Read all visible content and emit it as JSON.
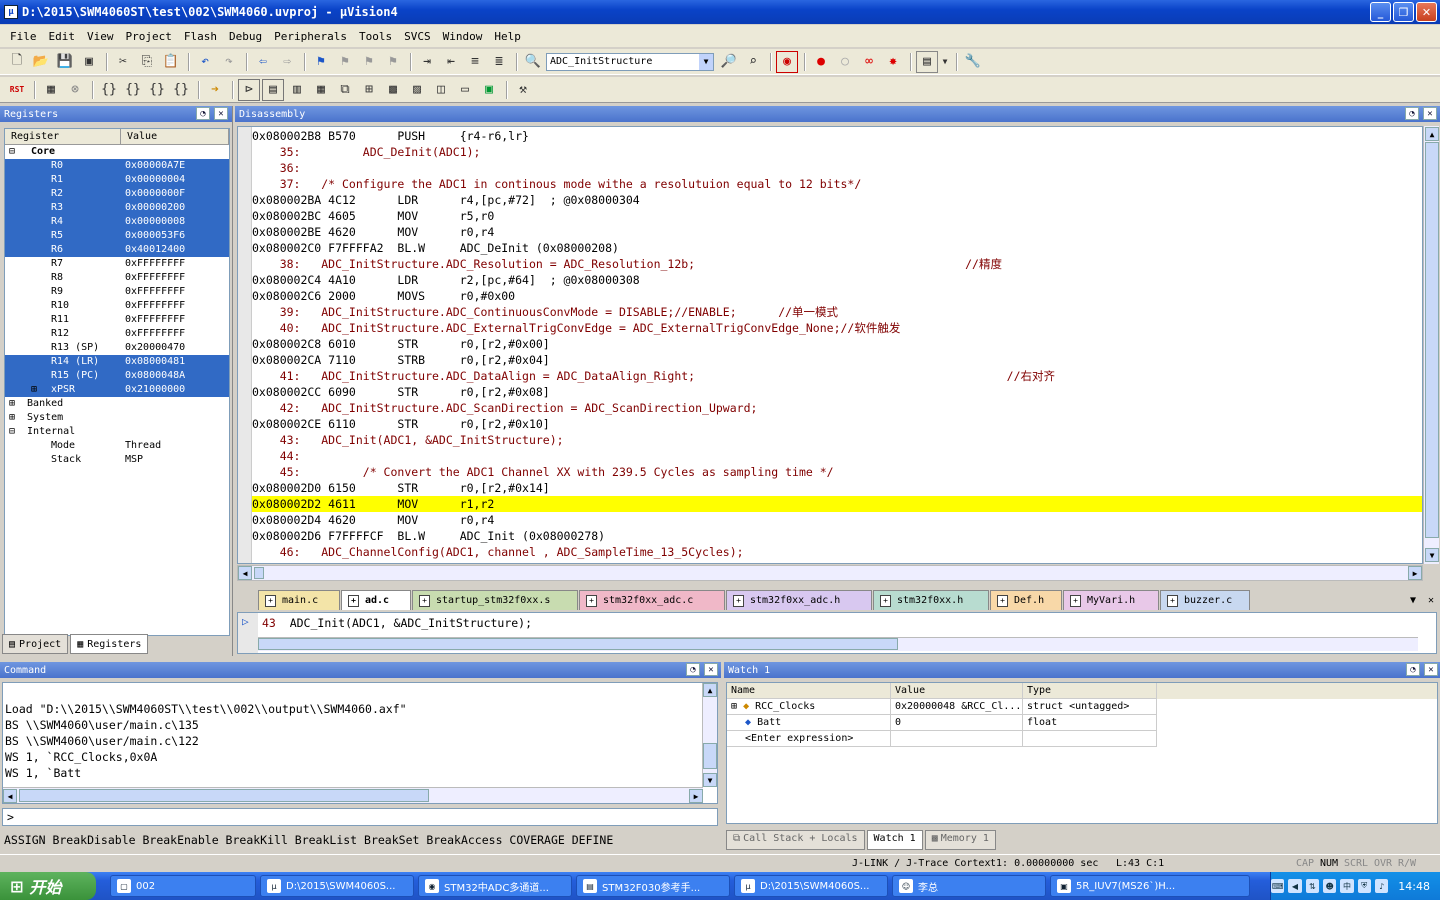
{
  "title": "D:\\2015\\SWM4060ST\\test\\002\\SWM4060.uvproj - µVision4",
  "menu": [
    "File",
    "Edit",
    "View",
    "Project",
    "Flash",
    "Debug",
    "Peripherals",
    "Tools",
    "SVCS",
    "Window",
    "Help"
  ],
  "toolbar": {
    "combo_value": "ADC_InitStructure",
    "rst": "RST"
  },
  "registers": {
    "title": "Registers",
    "col_register": "Register",
    "col_value": "Value",
    "core": "Core",
    "rows": [
      {
        "n": "R0",
        "v": "0x00000A7E",
        "sel": true
      },
      {
        "n": "R1",
        "v": "0x00000004",
        "sel": true
      },
      {
        "n": "R2",
        "v": "0x0000000F",
        "sel": true
      },
      {
        "n": "R3",
        "v": "0x00000200",
        "sel": true
      },
      {
        "n": "R4",
        "v": "0x00000008",
        "sel": true
      },
      {
        "n": "R5",
        "v": "0x000053F6",
        "sel": true
      },
      {
        "n": "R6",
        "v": "0x40012400",
        "sel": true
      },
      {
        "n": "R7",
        "v": "0xFFFFFFFF",
        "sel": false
      },
      {
        "n": "R8",
        "v": "0xFFFFFFFF",
        "sel": false
      },
      {
        "n": "R9",
        "v": "0xFFFFFFFF",
        "sel": false
      },
      {
        "n": "R10",
        "v": "0xFFFFFFFF",
        "sel": false
      },
      {
        "n": "R11",
        "v": "0xFFFFFFFF",
        "sel": false
      },
      {
        "n": "R12",
        "v": "0xFFFFFFFF",
        "sel": false
      },
      {
        "n": "R13 (SP)",
        "v": "0x20000470",
        "sel": false
      },
      {
        "n": "R14 (LR)",
        "v": "0x08000481",
        "sel": true
      },
      {
        "n": "R15 (PC)",
        "v": "0x0800048A",
        "sel": true
      },
      {
        "n": "xPSR",
        "v": "0x21000000",
        "sel": true
      }
    ],
    "banked": "Banked",
    "system": "System",
    "internal": "Internal",
    "mode_label": "Mode",
    "mode_value": "Thread",
    "stack_label": "Stack",
    "stack_value": "MSP",
    "tab_project": "Project",
    "tab_registers": "Registers"
  },
  "disassembly": {
    "title": "Disassembly",
    "lines": [
      {
        "t": "0x080002B8 B570      PUSH     {r4-r6,lr}",
        "k": "asm"
      },
      {
        "t": "    35:         ADC_DeInit(ADC1);",
        "k": "src"
      },
      {
        "t": "    36: ",
        "k": "src"
      },
      {
        "t": "    37:   /* Configure the ADC1 in continous mode withe a resolutuion equal to 12 bits*/",
        "k": "src"
      },
      {
        "t": "0x080002BA 4C12      LDR      r4,[pc,#72]  ; @0x08000304",
        "k": "asm"
      },
      {
        "t": "0x080002BC 4605      MOV      r5,r0",
        "k": "asm"
      },
      {
        "t": "0x080002BE 4620      MOV      r0,r4",
        "k": "asm"
      },
      {
        "t": "0x080002C0 F7FFFFA2  BL.W     ADC_DeInit (0x08000208)",
        "k": "asm"
      },
      {
        "t": "    38:   ADC_InitStructure.ADC_Resolution = ADC_Resolution_12b;                                       //精度",
        "k": "src"
      },
      {
        "t": "0x080002C4 4A10      LDR      r2,[pc,#64]  ; @0x08000308",
        "k": "asm"
      },
      {
        "t": "0x080002C6 2000      MOVS     r0,#0x00",
        "k": "asm"
      },
      {
        "t": "    39:   ADC_InitStructure.ADC_ContinuousConvMode = DISABLE;//ENABLE;      //单一模式",
        "k": "src"
      },
      {
        "t": "    40:   ADC_InitStructure.ADC_ExternalTrigConvEdge = ADC_ExternalTrigConvEdge_None;//软件触发",
        "k": "src"
      },
      {
        "t": "0x080002C8 6010      STR      r0,[r2,#0x00]",
        "k": "asm"
      },
      {
        "t": "0x080002CA 7110      STRB     r0,[r2,#0x04]",
        "k": "asm"
      },
      {
        "t": "    41:   ADC_InitStructure.ADC_DataAlign = ADC_DataAlign_Right;                                             //右对齐",
        "k": "src"
      },
      {
        "t": "0x080002CC 6090      STR      r0,[r2,#0x08]",
        "k": "asm"
      },
      {
        "t": "    42:   ADC_InitStructure.ADC_ScanDirection = ADC_ScanDirection_Upward;",
        "k": "src"
      },
      {
        "t": "0x080002CE 6110      STR      r0,[r2,#0x10]",
        "k": "asm"
      },
      {
        "t": "    43:   ADC_Init(ADC1, &ADC_InitStructure);",
        "k": "src"
      },
      {
        "t": "    44: ",
        "k": "src"
      },
      {
        "t": "    45:         /* Convert the ADC1 Channel XX with 239.5 Cycles as sampling time */",
        "k": "src"
      },
      {
        "t": "0x080002D0 6150      STR      r0,[r2,#0x14]",
        "k": "asm"
      },
      {
        "t": "0x080002D2 4611      MOV      r1,r2",
        "k": "hl"
      },
      {
        "t": "0x080002D4 4620      MOV      r0,r4",
        "k": "asm"
      },
      {
        "t": "0x080002D6 F7FFFFCF  BL.W     ADC_Init (0x08000278)",
        "k": "asm"
      },
      {
        "t": "    46:   ADC_ChannelConfig(ADC1, channel , ADC_SampleTime_13_5Cycles);",
        "k": "src"
      }
    ]
  },
  "file_tabs": [
    {
      "name": "main.c",
      "color": "#f3e4a8",
      "active": false
    },
    {
      "name": "ad.c",
      "color": "#f3e4a8",
      "active": true
    },
    {
      "name": "startup_stm32f0xx.s",
      "color": "#c8dcb0",
      "active": false
    },
    {
      "name": "stm32f0xx_adc.c",
      "color": "#f0b8c8",
      "active": false
    },
    {
      "name": "stm32f0xx_adc.h",
      "color": "#d8c8f0",
      "active": false
    },
    {
      "name": "stm32f0xx.h",
      "color": "#b8dcd0",
      "active": false
    },
    {
      "name": "Def.h",
      "color": "#f8d8a8",
      "active": false
    },
    {
      "name": "MyVari.h",
      "color": "#e8c8e8",
      "active": false
    },
    {
      "name": "buzzer.c",
      "color": "#c8d8f0",
      "active": false
    }
  ],
  "editor": {
    "line_no": "43",
    "code": "  ADC_Init(ADC1, &ADC_InitStructure);"
  },
  "command": {
    "title": "Command",
    "output": [
      "",
      "Load \"D:\\\\2015\\\\SWM4060ST\\\\test\\\\002\\\\output\\\\SWM4060.axf\"",
      "BS \\\\SWM4060\\user/main.c\\135",
      "BS \\\\SWM4060\\user/main.c\\122",
      "WS 1, `RCC_Clocks,0x0A",
      "WS 1, `Batt"
    ],
    "prompt": ">",
    "hints": "ASSIGN BreakDisable BreakEnable BreakKill BreakList BreakSet BreakAccess COVERAGE DEFINE"
  },
  "watch": {
    "title": "Watch 1",
    "col_name": "Name",
    "col_value": "Value",
    "col_type": "Type",
    "rows": [
      {
        "name": "RCC_Clocks",
        "value": "0x20000048 &RCC_Cl...",
        "type": "struct <untagged>"
      },
      {
        "name": "Batt",
        "value": "0",
        "type": "float"
      },
      {
        "name": "<Enter expression>",
        "value": "",
        "type": ""
      }
    ],
    "tabs": [
      "Call Stack + Locals",
      "Watch 1",
      "Memory 1"
    ]
  },
  "status": {
    "debugger": "J-LINK / J-Trace Cortex",
    "time": "t1: 0.00000000 sec",
    "pos": "L:43 C:1",
    "caps": "CAP",
    "num": "NUM",
    "scrl": "SCRL",
    "ovr": "OVR",
    "rw": "R/W"
  },
  "taskbar": {
    "start": "开始",
    "tasks": [
      {
        "label": "002",
        "w": 146
      },
      {
        "label": "D:\\2015\\SWM4060S...",
        "w": 154
      },
      {
        "label": "STM32中ADC多通道...",
        "w": 154
      },
      {
        "label": "STM32F030参考手...",
        "w": 154
      },
      {
        "label": "D:\\2015\\SWM4060S...",
        "w": 154
      },
      {
        "label": "李总",
        "w": 154
      },
      {
        "label": "5R_IUV7(MS26`)H...",
        "w": 200
      }
    ],
    "clock": "14:48"
  }
}
